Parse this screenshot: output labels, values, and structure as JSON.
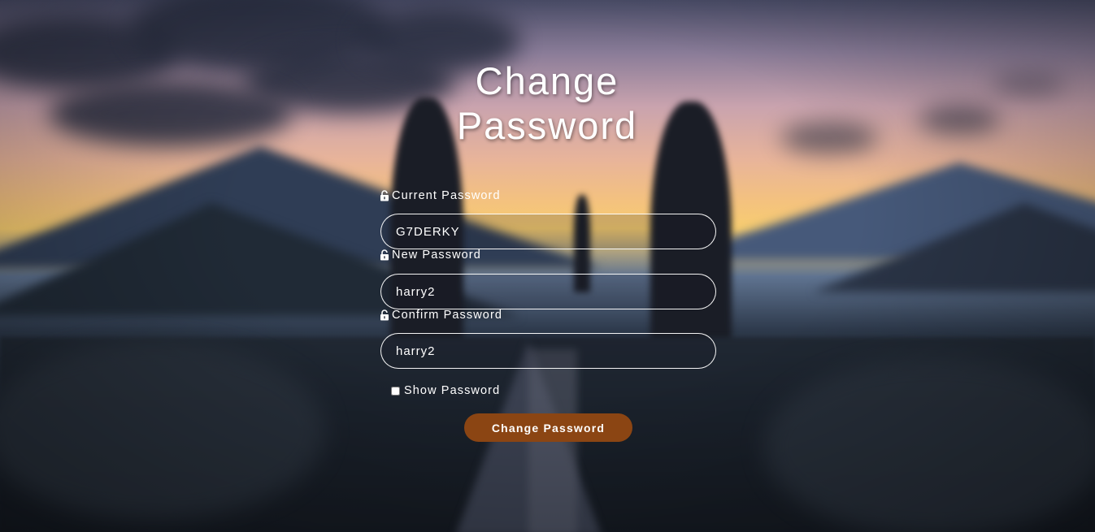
{
  "form": {
    "title_line1": "Change",
    "title_line2": "Password",
    "fields": [
      {
        "label": "Current Password",
        "value": "G7DERKY"
      },
      {
        "label": "New Password",
        "value": "harry2"
      },
      {
        "label": "Confirm Password",
        "value": "harry2"
      }
    ],
    "show_password": {
      "label": "Show Password",
      "checked": false
    },
    "submit_label": "Change Password"
  },
  "icons": {
    "field_icon": "unlock-icon"
  },
  "colors": {
    "button": "#8b4513",
    "text": "#ffffff",
    "input_border": "#ffffff"
  }
}
